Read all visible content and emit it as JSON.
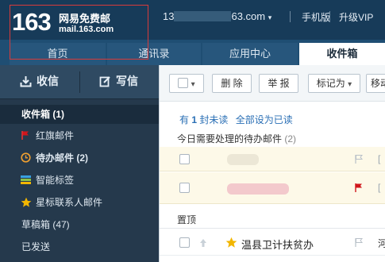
{
  "logo": {
    "number": "163",
    "name": "网易免费邮",
    "domain": "mail.163.com"
  },
  "header": {
    "account_prefix": "13",
    "account_suffix": "63.com",
    "links": [
      "手机版",
      "升级VIP"
    ]
  },
  "tabs": [
    {
      "label": "首页"
    },
    {
      "label": "通讯录"
    },
    {
      "label": "应用中心"
    },
    {
      "label": "收件箱"
    }
  ],
  "sidebar": {
    "receive_label": "收信",
    "compose_label": "写信",
    "items": [
      {
        "label": "收件箱 (1)",
        "icon": "none"
      },
      {
        "label": "红旗邮件",
        "icon": "red-flag-icon"
      },
      {
        "label": "待办邮件 (2)",
        "icon": "clock-icon"
      },
      {
        "label": "智能标签",
        "icon": "tag-stripes-icon"
      },
      {
        "label": "星标联系人邮件",
        "icon": "star-icon"
      },
      {
        "label": "草稿箱 (47)",
        "icon": "none"
      },
      {
        "label": "已发送",
        "icon": "none"
      }
    ]
  },
  "toolbar": {
    "delete_label": "删 除",
    "report_label": "举 报",
    "markas_label": "标记为",
    "move_label": "移动"
  },
  "list": {
    "summary_prefix": "有",
    "unread_count": "1",
    "summary_mid": "封未读",
    "mark_all_read": "全部设为已读",
    "todo_header": "今日需要处理的待办邮件",
    "todo_count": "(2)",
    "pinned_header": "置顶",
    "pinned_row_sender": "温县卫计扶贫办",
    "truncated_glyph": "[",
    "truncated_glyph_2": "河"
  },
  "colors": {
    "topbar": "#173b59",
    "sidebar": "#25394c",
    "accent_link": "#2a6fb5",
    "flag_red": "#d0161c",
    "star": "#f2b600"
  }
}
